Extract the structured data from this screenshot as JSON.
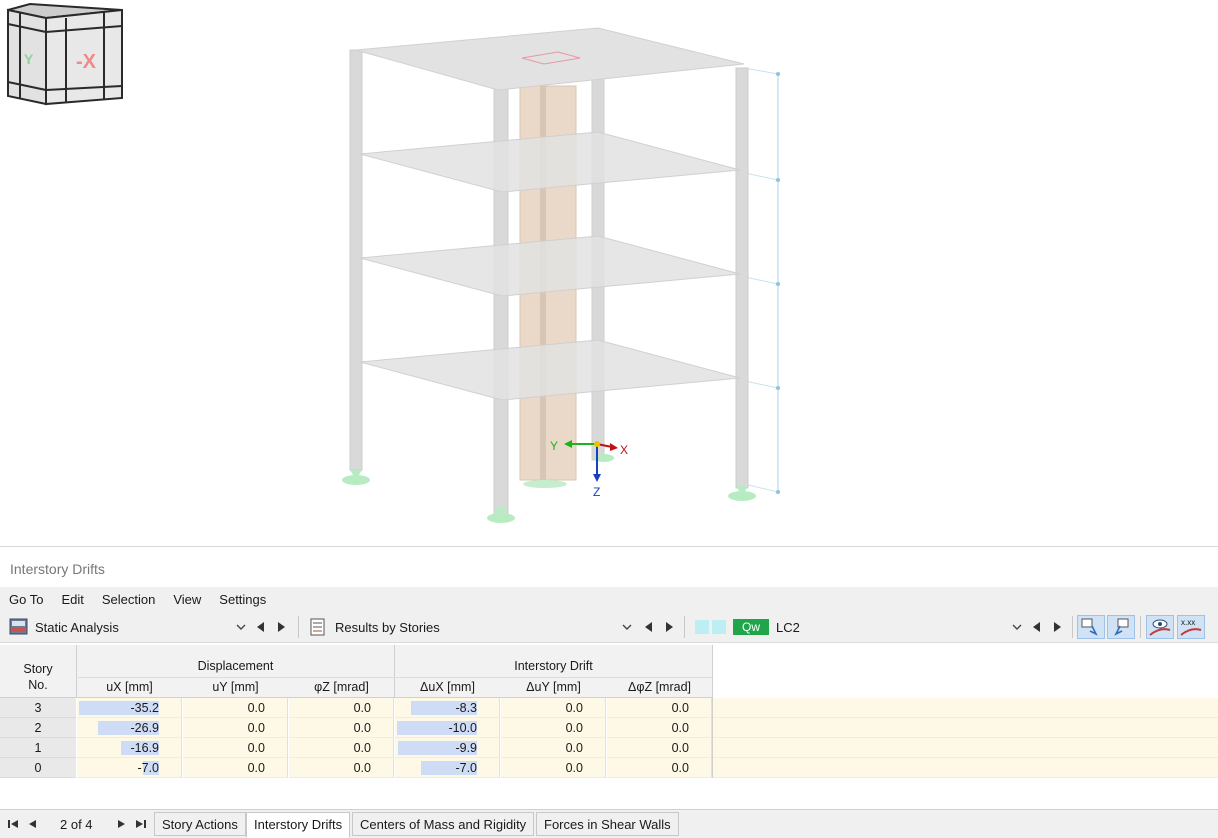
{
  "panel": {
    "title": "Interstory Drifts"
  },
  "menu": [
    "Go To",
    "Edit",
    "Selection",
    "View",
    "Settings"
  ],
  "toolbar": {
    "analysis": "Static Analysis",
    "results": "Results by Stories",
    "load_badge": "Qw",
    "load_case": "LC2"
  },
  "axes": {
    "x": "X",
    "y": "Y",
    "z": "Z"
  },
  "cube": {
    "neg_x": "-X",
    "y": "Y"
  },
  "table": {
    "story_header_1": "Story",
    "story_header_2": "No.",
    "group_displacement": "Displacement",
    "group_drift": "Interstory Drift",
    "columns": [
      "uX [mm]",
      "uY [mm]",
      "φZ [mrad]",
      "ΔuX [mm]",
      "ΔuY [mm]",
      "ΔφZ [mrad]"
    ],
    "rows": [
      {
        "story": "3",
        "ux": "-35.2",
        "uy": "0.0",
        "phz": "0.0",
        "dux": "-8.3",
        "duy": "0.0",
        "dphz": "0.0"
      },
      {
        "story": "2",
        "ux": "-26.9",
        "uy": "0.0",
        "phz": "0.0",
        "dux": "-10.0",
        "duy": "0.0",
        "dphz": "0.0"
      },
      {
        "story": "1",
        "ux": "-16.9",
        "uy": "0.0",
        "phz": "0.0",
        "dux": "-9.9",
        "duy": "0.0",
        "dphz": "0.0"
      },
      {
        "story": "0",
        "ux": "-7.0",
        "uy": "0.0",
        "phz": "0.0",
        "dux": "-7.0",
        "duy": "0.0",
        "dphz": "0.0"
      }
    ]
  },
  "pager": {
    "label": "2 of 4"
  },
  "tabs": [
    "Story Actions",
    "Interstory Drifts",
    "Centers of Mass and Rigidity",
    "Forces in Shear Walls"
  ],
  "colors": {
    "bar": "#cfdcf5",
    "row_bg": "#fdf9e6",
    "badge": "#1fa64a"
  }
}
